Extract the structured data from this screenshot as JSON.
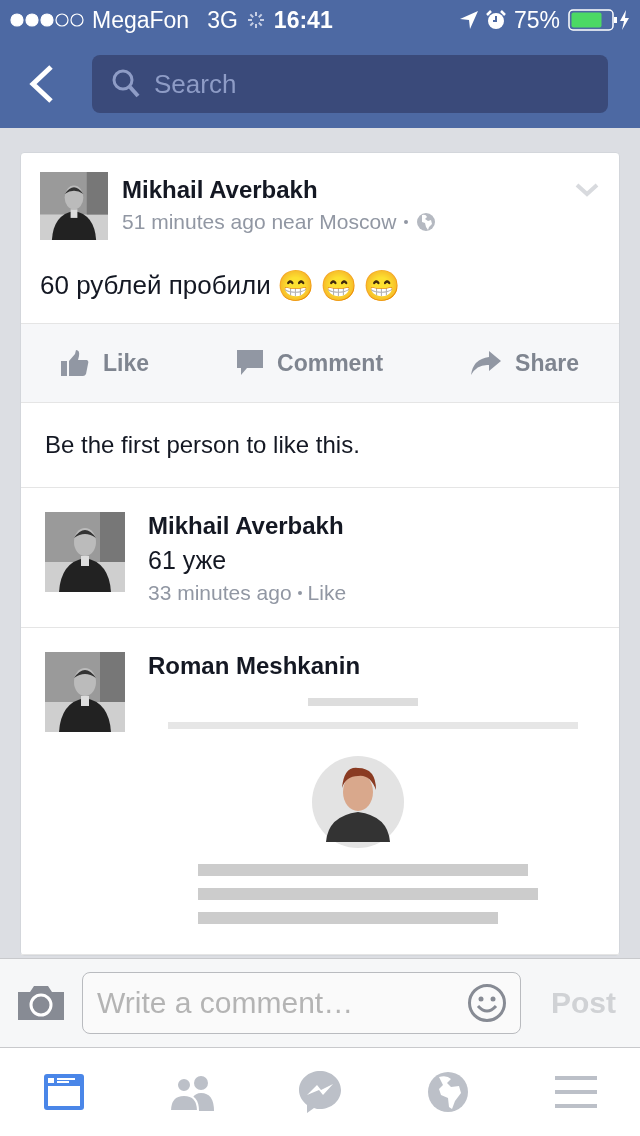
{
  "status_bar": {
    "carrier": "MegaFon",
    "network": "3G",
    "time": "16:41",
    "battery": "75%"
  },
  "nav_bar": {
    "search": {
      "placeholder": "Search"
    }
  },
  "post": {
    "author": "Mikhail Averbakh",
    "meta": "51 minutes ago near Moscow",
    "text": "60 рублей пробили",
    "emoji": [
      "😁",
      "😁",
      "😁"
    ],
    "actions": [
      {
        "kind": "like",
        "label": "Like"
      },
      {
        "kind": "comment",
        "label": "Comment"
      },
      {
        "kind": "share",
        "label": "Share"
      }
    ],
    "likes_text": "Be the first person to like this."
  },
  "comments": [
    {
      "author": "Mikhail Averbakh",
      "text": "61 уже",
      "time": "33 minutes ago",
      "action": "Like"
    },
    {
      "author": "Roman  Meshkanin"
    }
  ],
  "composer": {
    "placeholder": "Write a comment…",
    "post": "Post"
  },
  "tab_bar": [
    {
      "kind": "feed",
      "selected": true
    },
    {
      "kind": "friends",
      "selected": false
    },
    {
      "kind": "messenger",
      "selected": false
    },
    {
      "kind": "globe",
      "selected": false
    },
    {
      "kind": "menu",
      "selected": false
    }
  ]
}
